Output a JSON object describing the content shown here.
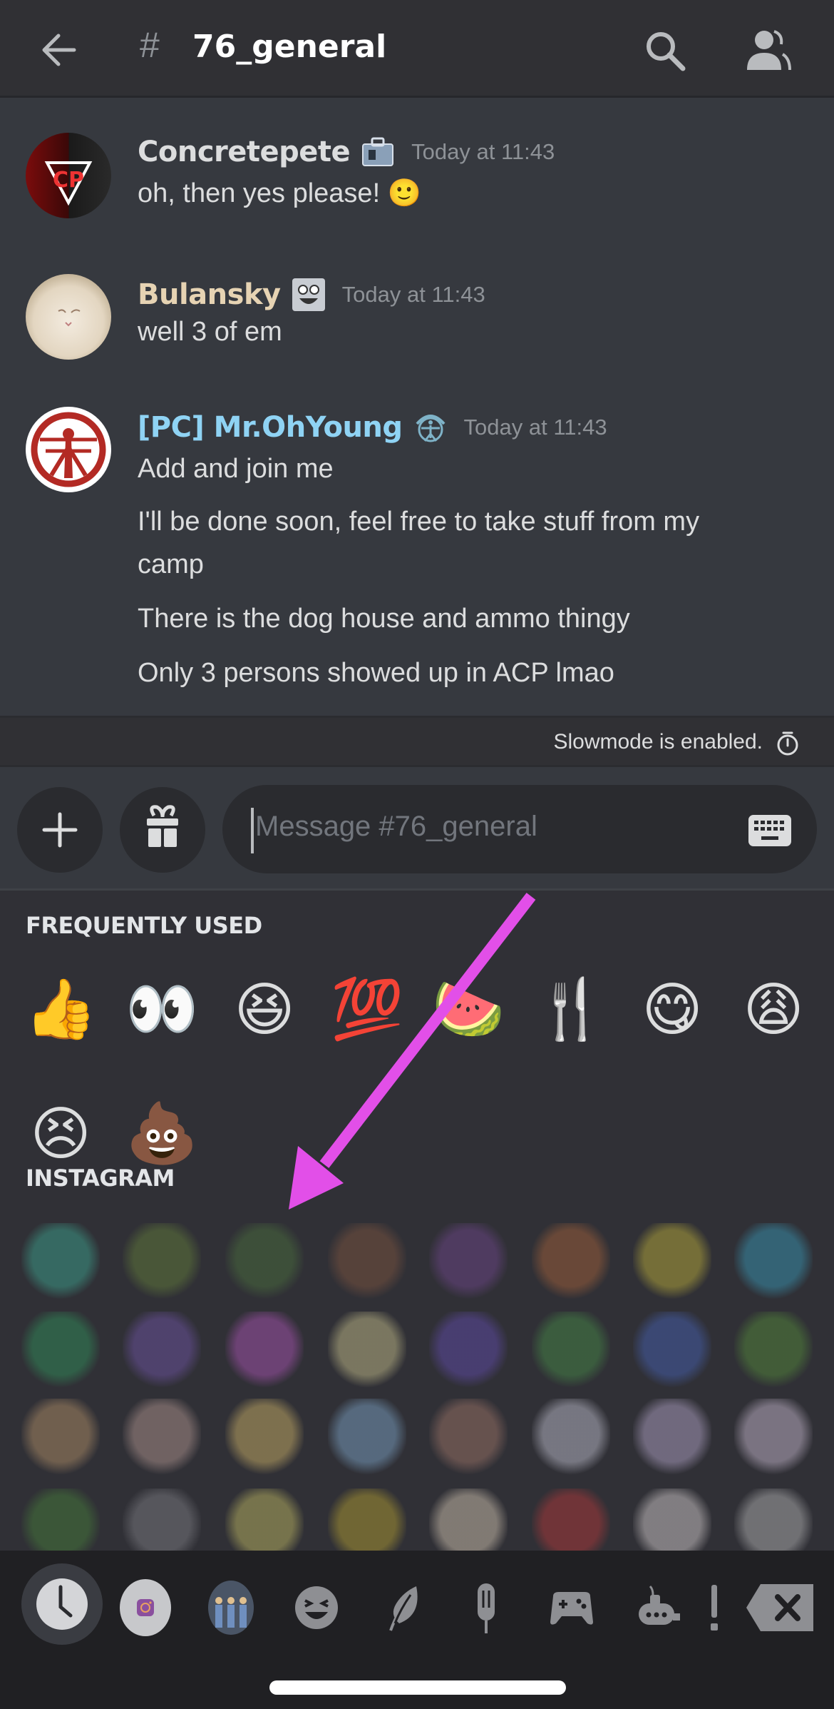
{
  "header": {
    "back_icon": "arrow-left-icon",
    "hash_symbol": "#",
    "channel_name": "76_general",
    "search_icon": "search-icon",
    "members_icon": "members-icon"
  },
  "messages": [
    {
      "author": "Concretepete",
      "author_color": "#dcddde",
      "badge": "briefcase-badge",
      "timestamp": "Today at 11:43",
      "lines": [
        "oh, then yes please! 🙂"
      ]
    },
    {
      "author": "Bulansky",
      "author_color": "#e6d3b3",
      "badge": "smiley-badge",
      "timestamp": "Today at 11:43",
      "lines": [
        "well 3 of em"
      ]
    },
    {
      "author": "[PC] Mr.OhYoung",
      "author_color": "#8fd3f4",
      "badge": "vitruvian-badge",
      "timestamp": "Today at 11:43",
      "lines": [
        "Add and join me",
        "I'll be done soon, feel free to take stuff from my",
        "camp",
        "There is the dog house and ammo thingy",
        "Only 3 persons showed up in ACP lmao"
      ]
    }
  ],
  "slowmode": {
    "text": "Slowmode is enabled.",
    "icon": "timer-icon"
  },
  "composer": {
    "plus_icon": "plus-icon",
    "gift_icon": "gift-icon",
    "placeholder": "Message #76_general",
    "value": "",
    "keyboard_icon": "keyboard-icon"
  },
  "emoji_panel": {
    "frequently_used_title": "FREQUENTLY USED",
    "frequently_used": [
      "👍",
      "👀",
      "😆",
      "💯",
      "🍉",
      "🍴",
      "😋",
      "😩",
      "😣",
      "💩"
    ],
    "instagram_title": "INSTAGRAM",
    "custom_emojis": [
      "diamond-logo",
      "pepe-king",
      "pepe-hug",
      "face-closeup",
      "potion",
      "level-up",
      "pikachu",
      "welcome",
      "spotify",
      "twitch",
      "exclamation",
      "star",
      "purple-star",
      "pepe",
      "wizard-anime",
      "tree",
      "anime-girl-1",
      "anime-girl-2",
      "anime-girl-3",
      "anime-girl-4",
      "anime-girl-5",
      "anime-girl-6",
      "anime-girl-7",
      "anime-girl-8",
      "pepe-blush",
      "moon",
      "moon-star",
      "yellow-face",
      "cat",
      "red-hair-girl",
      "rose",
      "crown"
    ]
  },
  "category_tabs": [
    {
      "name": "recent",
      "icon": "clock-icon",
      "active": true
    },
    {
      "name": "instagram",
      "icon": "instagram-icon",
      "active": false
    },
    {
      "name": "server",
      "icon": "server-avatar-icon",
      "active": false
    },
    {
      "name": "people",
      "icon": "smiley-icon",
      "active": false
    },
    {
      "name": "nature",
      "icon": "leaf-icon",
      "active": false
    },
    {
      "name": "food",
      "icon": "popsicle-icon",
      "active": false
    },
    {
      "name": "activities",
      "icon": "gamepad-icon",
      "active": false
    },
    {
      "name": "travel",
      "icon": "submarine-icon",
      "active": false
    },
    {
      "name": "symbols",
      "icon": "exclamation-icon",
      "active": false
    },
    {
      "name": "backspace",
      "icon": "backspace-icon",
      "active": false
    }
  ],
  "annotation": {
    "arrow_color": "#e24fe8"
  }
}
